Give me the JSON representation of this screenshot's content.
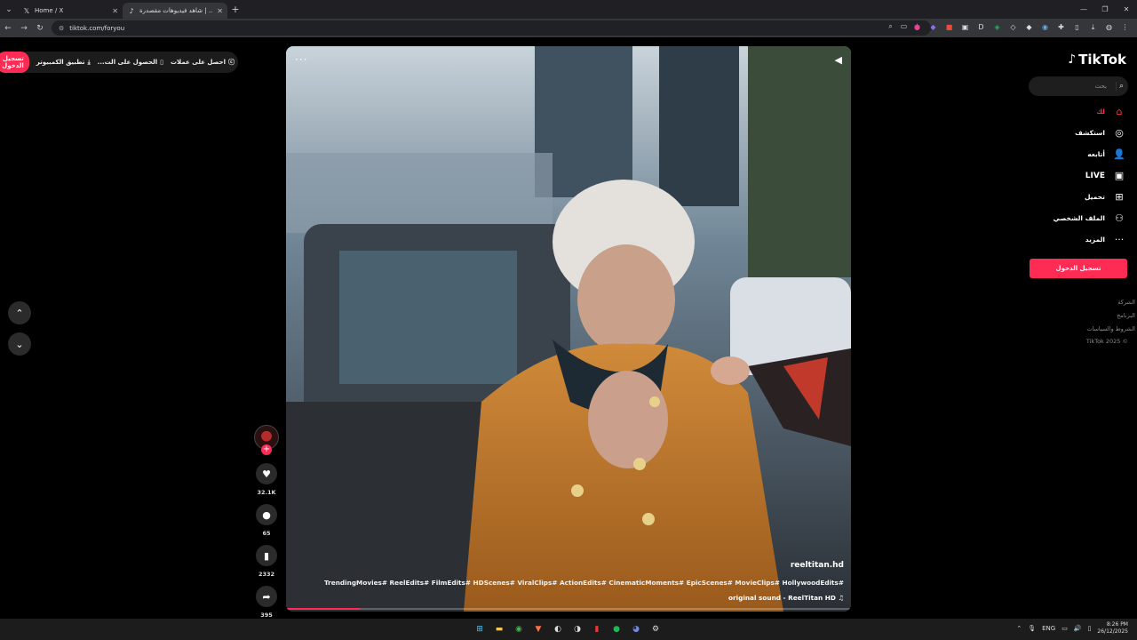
{
  "browser": {
    "tabs": [
      {
        "label": "Home / X",
        "icon": "x-logo-icon",
        "active": false
      },
      {
        "label": "شاهد فيديوهات مقصدرة | ...",
        "icon": "tiktok-icon",
        "active": true
      }
    ],
    "url": "tiktok.com/foryou"
  },
  "topbar": {
    "coins": "احصل على عملات",
    "get_pc": "الحصول على الت...",
    "app": "تطبيق الكمبيوتر",
    "login": "تسجيل الدخول"
  },
  "video": {
    "username": "reeltitan.hd",
    "hashtags": "TrendingMovies# ReelEdits# FilmEdits# HDScenes# ViralClips# ActionEdits# CinematicMoments# EpicScenes# MovieClips# HollywoodEdits#",
    "sound": "original sound - ReelTitan HD",
    "progress": 0.13
  },
  "actions": {
    "likes": "32.1K",
    "comments": "65",
    "saves": "2332",
    "shares": "395"
  },
  "sidebar": {
    "logo": "TikTok",
    "search_placeholder": "بحث",
    "items": [
      {
        "label": "لك",
        "icon": "home-icon"
      },
      {
        "label": "استكشف",
        "icon": "compass-icon"
      },
      {
        "label": "أتابعه",
        "icon": "following-icon"
      },
      {
        "label": "LIVE",
        "icon": "live-icon"
      },
      {
        "label": "تحميل",
        "icon": "upload-icon"
      },
      {
        "label": "الملف الشخصي",
        "icon": "profile-icon"
      },
      {
        "label": "المزيد",
        "icon": "more-icon"
      }
    ],
    "login": "تسجيل الدخول",
    "footer": [
      "الشركة",
      "البرنامج",
      "الشروط والسياسات",
      "TikTok 2025 ©"
    ]
  },
  "taskbar": {
    "lang": "ENG",
    "time": "8:26 PM",
    "date": "26/12/2025"
  },
  "colors": {
    "accent": "#fe2c55"
  }
}
